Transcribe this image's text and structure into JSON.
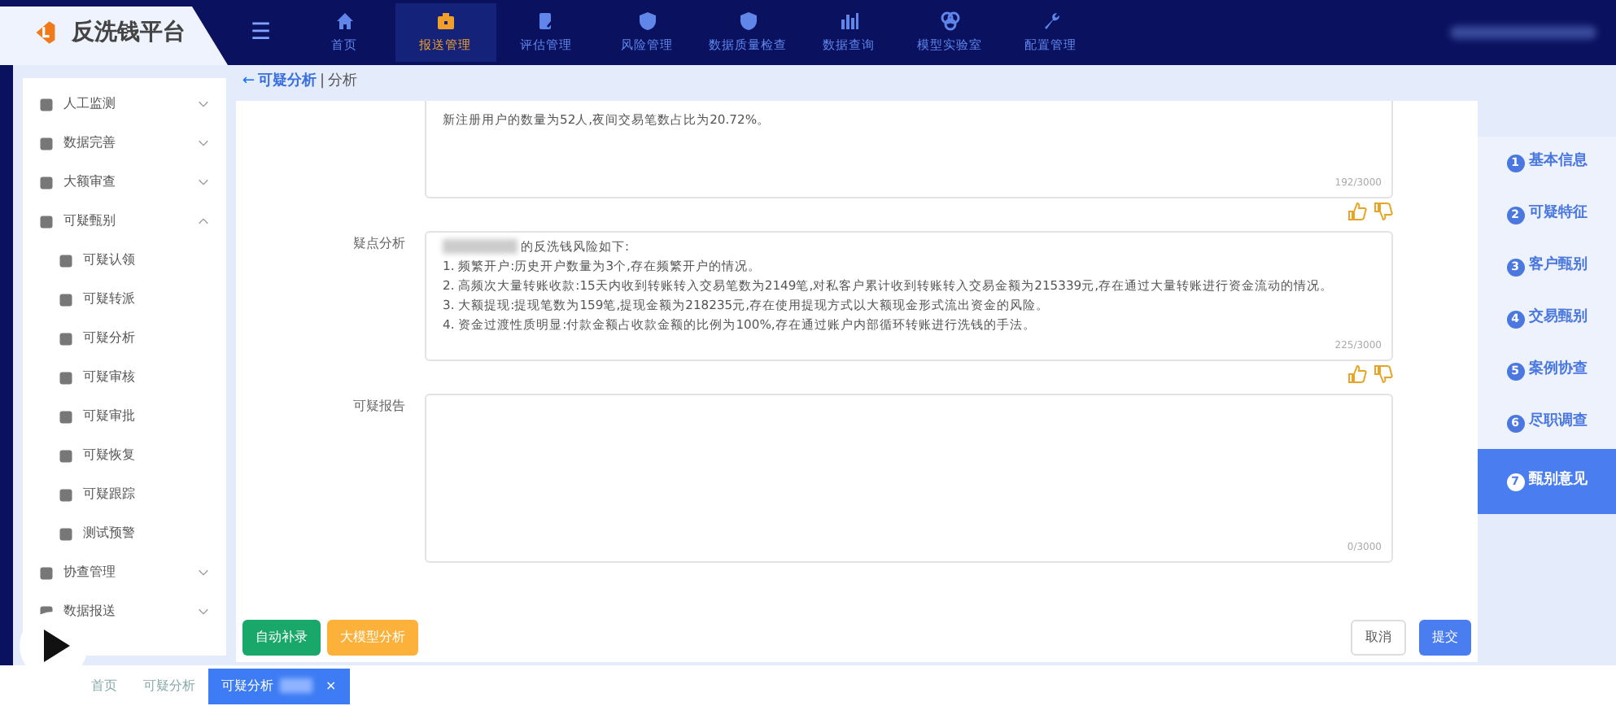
{
  "app": {
    "title": "反洗钱平台",
    "menu_icon": "☰"
  },
  "top_nav": [
    {
      "label": "首页",
      "selected": false
    },
    {
      "label": "报送管理",
      "selected": true
    },
    {
      "label": "评估管理",
      "selected": false
    },
    {
      "label": "风险管理",
      "selected": false
    },
    {
      "label": "数据质量检查",
      "selected": false
    },
    {
      "label": "数据查询",
      "selected": false
    },
    {
      "label": "模型实验室",
      "selected": false
    },
    {
      "label": "配置管理",
      "selected": false
    }
  ],
  "sidebar": {
    "items": [
      {
        "label": "人工监测",
        "expanded": false,
        "selected": false
      },
      {
        "label": "数据完善",
        "expanded": false,
        "selected": false
      },
      {
        "label": "大额审查",
        "expanded": false,
        "selected": false
      },
      {
        "label": "可疑甄别",
        "expanded": true,
        "selected": false,
        "children": [
          {
            "label": "可疑认领",
            "selected": false
          },
          {
            "label": "可疑转派",
            "selected": false
          },
          {
            "label": "可疑分析",
            "selected": false
          },
          {
            "label": "可疑审核",
            "selected": false
          },
          {
            "label": "可疑审批",
            "selected": false
          },
          {
            "label": "可疑恢复",
            "selected": false
          },
          {
            "label": "可疑跟踪",
            "selected": false
          },
          {
            "label": "测试预警",
            "selected": false
          }
        ]
      },
      {
        "label": "协查管理",
        "expanded": false,
        "selected": false
      },
      {
        "label": "数据报送",
        "expanded": false,
        "selected": false
      }
    ]
  },
  "breadcrumb": {
    "back": "←",
    "parent": "可疑分析",
    "separator": "|",
    "current": "分析"
  },
  "fields": [
    {
      "lines": [
        "新注册用户的数量为52人,夜间交易笔数占比为20.72%。"
      ],
      "count": "192/3000",
      "feedback": true
    },
    {
      "label": "疑点分析",
      "lines": [
        "的反洗钱风险如下:",
        "1. 频繁开户:历史开户数量为3个,存在频繁开户的情况。",
        "2. 高频次大量转账收款:15天内收到转账转入交易笔数为2149笔,对私客户累计收到转账转入交易金额为215339元,存在通过大量转账进行资金流动的情况。",
        "3. 大额提现:提现笔数为159笔,提现金额为218235元,存在使用提现方式以大额现金形式流出资金的风险。",
        "4. 资金过渡性质明显:付款金额占收款金额的比例为100%,存在通过账户内部循环转账进行洗钱的手法。"
      ],
      "count": "225/3000",
      "feedback": true,
      "redacted_lead": true
    },
    {
      "label": "可疑报告",
      "count": "0/3000"
    }
  ],
  "actions": [
    {
      "label": "自动补录",
      "kind": "success"
    },
    {
      "label": "大模型分析",
      "kind": "warning"
    }
  ],
  "footer_buttons": [
    {
      "label": "取消",
      "kind": "plain"
    },
    {
      "label": "提交",
      "kind": "primary"
    }
  ],
  "steps": [
    {
      "number": "1",
      "label": "基本信息",
      "selected": false
    },
    {
      "number": "2",
      "label": "可疑特征",
      "selected": false
    },
    {
      "number": "3",
      "label": "客户甄别",
      "selected": false
    },
    {
      "number": "4",
      "label": "交易甄别",
      "selected": false
    },
    {
      "number": "5",
      "label": "案例协查",
      "selected": false
    },
    {
      "number": "6",
      "label": "尽职调查",
      "selected": false
    },
    {
      "number": "7",
      "label": "甄别意见",
      "selected": true
    }
  ],
  "tabs": [
    {
      "label": "首页",
      "selected": false
    },
    {
      "label": "可疑分析",
      "selected": false
    },
    {
      "label": "可疑分析",
      "selected": true,
      "closable": true
    }
  ],
  "close_glyph": "×"
}
